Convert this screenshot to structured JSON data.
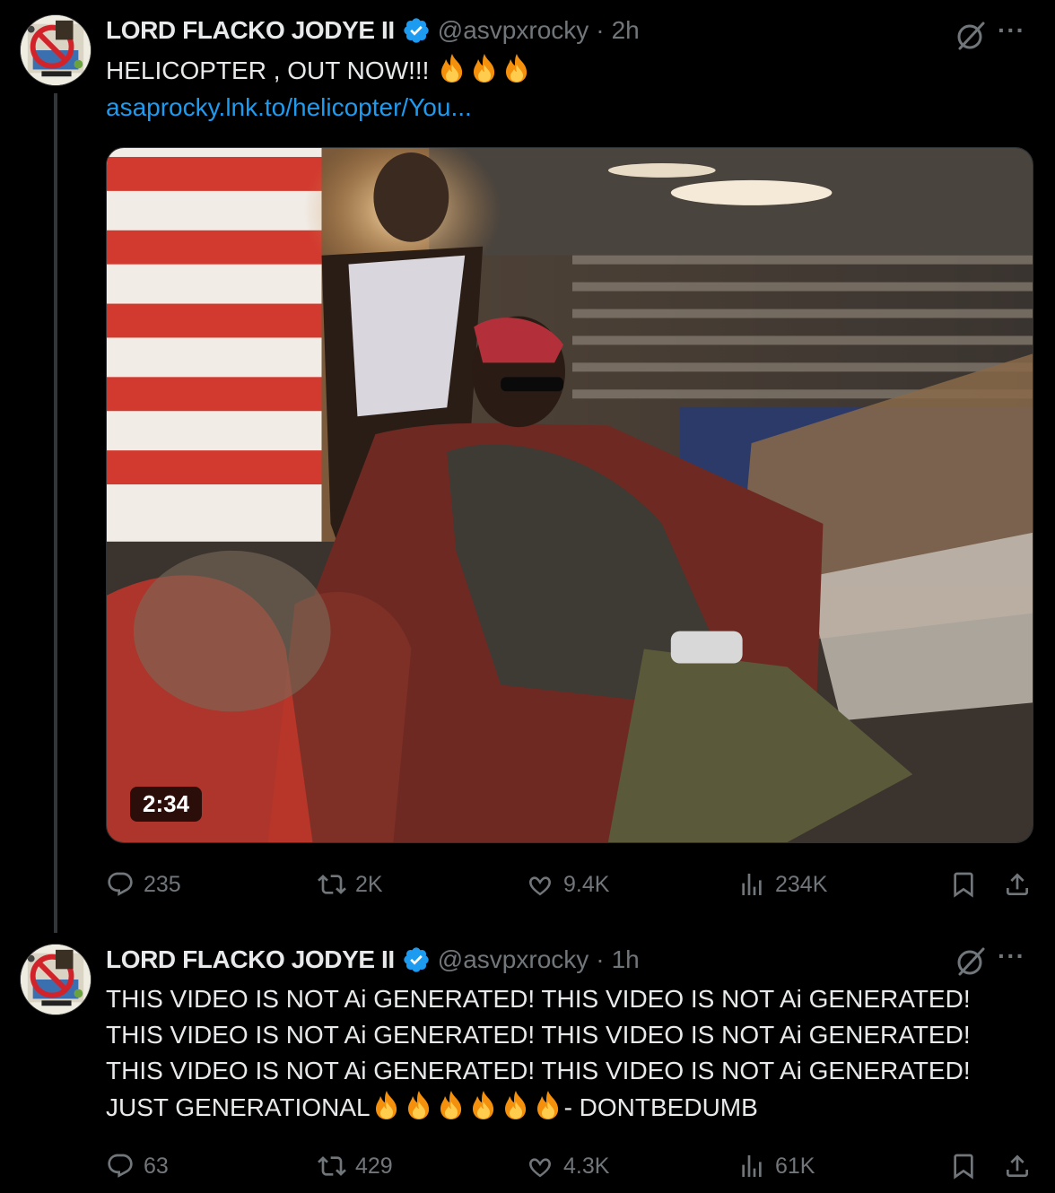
{
  "tweets": [
    {
      "display_name": "LORD FLACKO JODYE II",
      "handle": "@asvpxrocky",
      "separator": "·",
      "time": "2h",
      "text": "HELICOPTER , OUT NOW!!!",
      "fire_count": 3,
      "link": "asaprocky.lnk.to/helicopter/You...",
      "video": {
        "duration": "2:34"
      },
      "stats": {
        "replies": "235",
        "reposts": "2K",
        "likes": "9.4K",
        "views": "234K"
      }
    },
    {
      "display_name": "LORD FLACKO JODYE II",
      "handle": "@asvpxrocky",
      "separator": "·",
      "time": "1h",
      "text_lines": [
        "THIS VIDEO IS NOT Ai GENERATED! THIS VIDEO IS NOT Ai GENERATED!",
        "THIS VIDEO IS NOT Ai GENERATED! THIS VIDEO IS NOT Ai GENERATED!",
        "THIS VIDEO IS NOT Ai GENERATED! THIS VIDEO IS NOT Ai GENERATED!"
      ],
      "last_line_start": "JUST GENERATIONAL",
      "last_line_end": "- DONTBEDUMB",
      "fire_count": 6,
      "stats": {
        "replies": "63",
        "reposts": "429",
        "likes": "4.3K",
        "views": "61K"
      }
    }
  ],
  "more_label": "···",
  "icons": {
    "verified": "verified-badge-icon",
    "grok": "grok-icon",
    "reply": "reply-icon",
    "repost": "repost-icon",
    "like": "heart-icon",
    "views": "views-icon",
    "bookmark": "bookmark-icon",
    "share": "share-icon",
    "fire": "fire-emoji"
  },
  "colors": {
    "background": "#000000",
    "text": "#e7e9ea",
    "muted": "#71767b",
    "link": "#1d9bf0",
    "verified": "#1d9bf0"
  }
}
